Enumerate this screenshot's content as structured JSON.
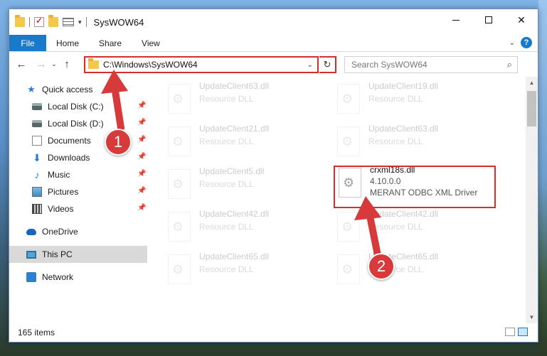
{
  "window": {
    "title": "SysWOW64"
  },
  "ribbon": {
    "tabs": [
      "File",
      "Home",
      "Share",
      "View"
    ]
  },
  "address": {
    "path": "C:\\Windows\\SysWOW64",
    "search_placeholder": "Search SysWOW64"
  },
  "nav": {
    "items": [
      {
        "label": "Quick access"
      },
      {
        "label": "Local Disk (C:)"
      },
      {
        "label": "Local Disk (D:)"
      },
      {
        "label": "Documents"
      },
      {
        "label": "Downloads"
      },
      {
        "label": "Music"
      },
      {
        "label": "Pictures"
      },
      {
        "label": "Videos"
      },
      {
        "label": "OneDrive"
      },
      {
        "label": "This PC"
      },
      {
        "label": "Network"
      }
    ]
  },
  "files": [
    {
      "name": "UpdateClient63.dll",
      "desc": "Resource DLL"
    },
    {
      "name": "UpdateClient19.dll",
      "desc": "Resource DLL"
    },
    {
      "name": "UpdateClient21.dll",
      "desc": "Resource DLL"
    },
    {
      "name": "UpdateClient63.dll",
      "desc": "Resource DLL"
    },
    {
      "name": "UpdateClient5.dll",
      "desc": "Resource DLL"
    },
    {
      "name": "crxml18s.dll",
      "version": "4.10.0.0",
      "desc": "MERANT ODBC XML Driver"
    },
    {
      "name": "UpdateClient42.dll",
      "desc": "Resource DLL"
    },
    {
      "name": "UpdateClient42.dll",
      "desc": "Resource DLL"
    },
    {
      "name": "UpdateClient65.dll",
      "desc": "Resource DLL"
    },
    {
      "name": "UpdateClient65.dll",
      "desc": "Resource DLL"
    }
  ],
  "status": {
    "item_count": "165 items"
  },
  "annotations": {
    "step1": "1",
    "step2": "2"
  },
  "colors": {
    "accent": "#1979ca",
    "highlight": "#d62d2d"
  }
}
